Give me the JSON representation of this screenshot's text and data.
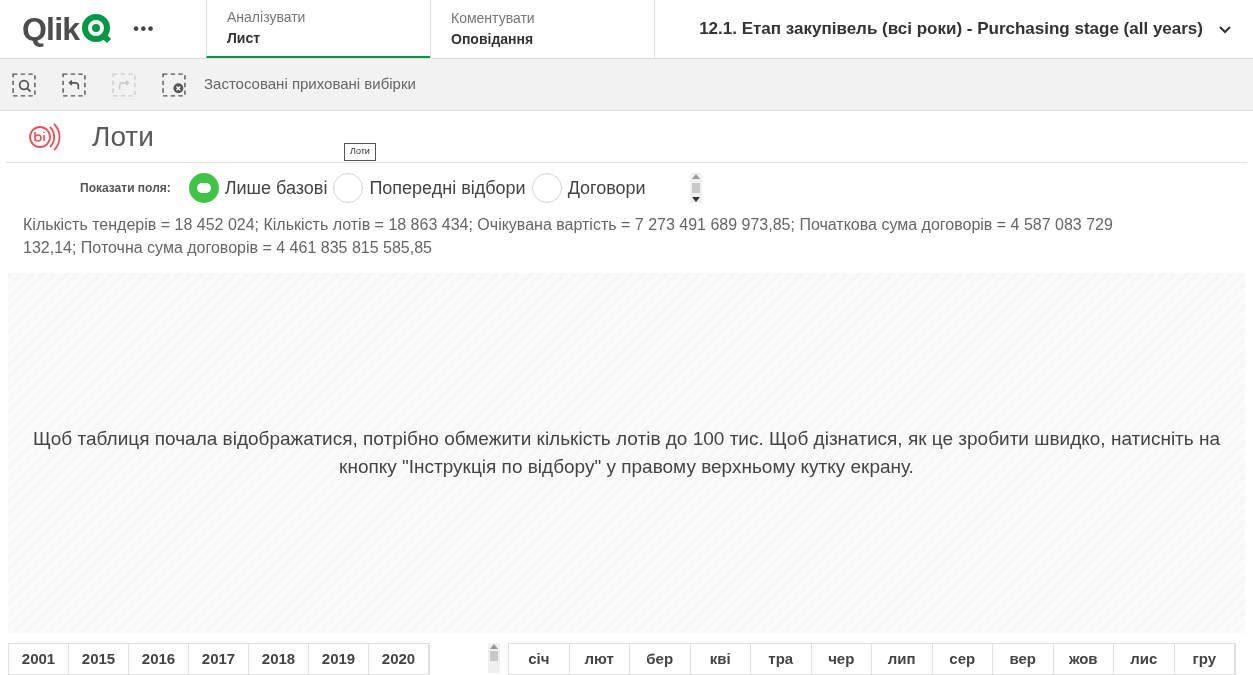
{
  "header": {
    "logo": "Qlik",
    "more": "•••",
    "tabs": [
      {
        "label": "Аналізувати",
        "sub": "Лист",
        "selected": true
      },
      {
        "label": "Коментувати",
        "sub": "Оповідання",
        "selected": false
      }
    ],
    "sheet_title": "12.1. Етап закупівель (всі роки) - Purchasing stage (all years)"
  },
  "toolbar": {
    "tools": [
      {
        "kind": "search",
        "disabled": false
      },
      {
        "kind": "back",
        "disabled": false
      },
      {
        "kind": "forward",
        "disabled": true
      },
      {
        "kind": "clear",
        "disabled": false
      }
    ],
    "label": "Застосовані приховані вибірки"
  },
  "sheet": {
    "title": "Лоти",
    "tooltip": "Лоти"
  },
  "fields": {
    "label": "Показати поля:",
    "options": [
      {
        "label": "Лише базові",
        "selected": true
      },
      {
        "label": "Попередні відбори",
        "selected": false
      },
      {
        "label": "Договори",
        "selected": false
      }
    ]
  },
  "summary": "Кількість тендерів = 18 452 024; Кількість лотів = 18 863 434; Очікувана вартість = 7 273 491 689 973,85; Початкова сума договорів = 4 587 083 729 132,14; Поточна сума договорів = 4 461 835 815 585,85",
  "message": "Щоб таблиця почала відображатися, потрібно обмежити кількість лотів до 100 тис. Щоб дізнатися, як це зробити швидко, натисніть на кнопку \"Інструкція по відбору\" у правому верхньому кутку екрану.",
  "years": [
    "2001",
    "2015",
    "2016",
    "2017",
    "2018",
    "2019",
    "2020"
  ],
  "months": [
    "січ",
    "лют",
    "бер",
    "кві",
    "тра",
    "чер",
    "лип",
    "сер",
    "вер",
    "жов",
    "лис",
    "гру"
  ]
}
